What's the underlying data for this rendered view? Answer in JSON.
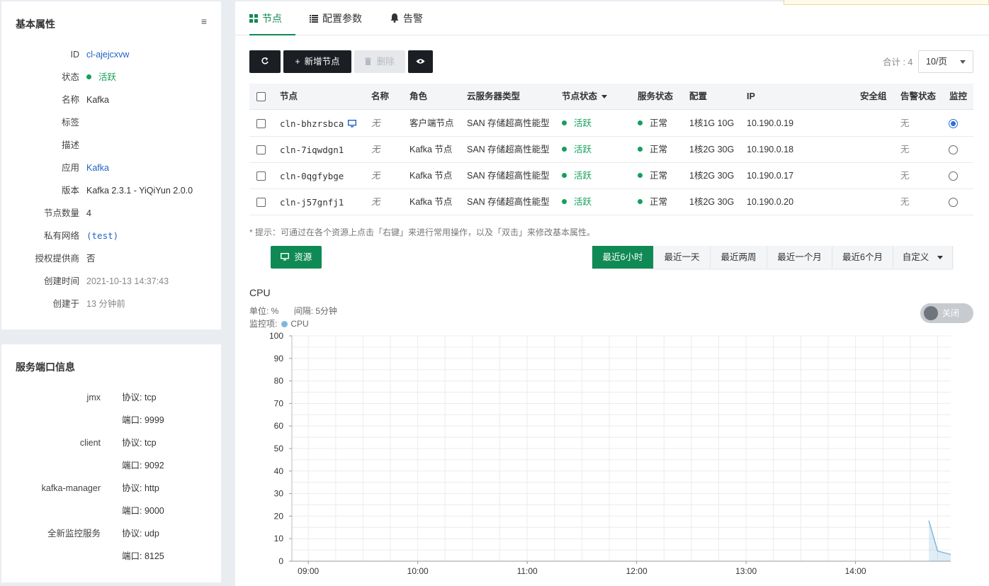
{
  "basic_info": {
    "title": "基本属性",
    "rows": [
      {
        "label": "ID",
        "value": "cl-ajejcxvw",
        "style": "link"
      },
      {
        "label": "状态",
        "value": "活跃",
        "style": "status"
      },
      {
        "label": "名称",
        "value": "Kafka",
        "style": "plain"
      },
      {
        "label": "标签",
        "value": "",
        "style": "plain"
      },
      {
        "label": "描述",
        "value": "",
        "style": "plain"
      },
      {
        "label": "应用",
        "value": "Kafka",
        "style": "link"
      },
      {
        "label": "版本",
        "value": "Kafka 2.3.1 - YiQiYun 2.0.0",
        "style": "plain"
      },
      {
        "label": "节点数量",
        "value": "4",
        "style": "plain"
      },
      {
        "label": "私有网络",
        "value": "(test)",
        "style": "link-mono"
      },
      {
        "label": "授权提供商",
        "value": "否",
        "style": "plain"
      },
      {
        "label": "创建时间",
        "value": "2021-10-13 14:37:43",
        "style": "gray"
      },
      {
        "label": "创建于",
        "value": "13 分钟前",
        "style": "gray"
      }
    ]
  },
  "ports_info": {
    "title": "服务端口信息",
    "rows": [
      {
        "label": "jmx",
        "value": "协议: tcp"
      },
      {
        "label": "",
        "value": "端口: 9999"
      },
      {
        "label": "client",
        "value": "协议: tcp"
      },
      {
        "label": "",
        "value": "端口: 9092"
      },
      {
        "label": "kafka-manager",
        "value": "协议: http"
      },
      {
        "label": "",
        "value": "端口: 9000"
      },
      {
        "label": "全新监控服务",
        "value": "协议: udp"
      },
      {
        "label": "",
        "value": "端口: 8125"
      }
    ]
  },
  "tabs": [
    {
      "label": "节点",
      "icon": "grid-icon",
      "active": true
    },
    {
      "label": "配置参数",
      "icon": "list-icon",
      "active": false
    },
    {
      "label": "告警",
      "icon": "bell-icon",
      "active": false
    }
  ],
  "toolbar": {
    "refresh_icon": "refresh-icon",
    "add_label": "新增节点",
    "delete_label": "删除",
    "view_icon": "eye-icon",
    "total_label": "合计 : 4",
    "page_size": "10/页"
  },
  "table": {
    "columns": [
      "节点",
      "名称",
      "角色",
      "云服务器类型",
      "节点状态",
      "服务状态",
      "配置",
      "IP",
      "安全组",
      "告警状态",
      "监控"
    ],
    "rows": [
      {
        "node": "cln-bhzrsbca",
        "name": "无",
        "role": "客户端节点",
        "type": "SAN 存储超高性能型",
        "node_status": "活跃",
        "service_status": "正常",
        "config": "1核1G 10G",
        "ip": "10.190.0.19",
        "security_group": "",
        "alert": "无",
        "monitored": true,
        "has_vnc": true
      },
      {
        "node": "cln-7iqwdgn1",
        "name": "无",
        "role": "Kafka 节点",
        "type": "SAN 存储超高性能型",
        "node_status": "活跃",
        "service_status": "正常",
        "config": "1核2G 30G",
        "ip": "10.190.0.18",
        "security_group": "",
        "alert": "无",
        "monitored": false,
        "has_vnc": false
      },
      {
        "node": "cln-0qgfybge",
        "name": "无",
        "role": "Kafka 节点",
        "type": "SAN 存储超高性能型",
        "node_status": "活跃",
        "service_status": "正常",
        "config": "1核2G 30G",
        "ip": "10.190.0.17",
        "security_group": "",
        "alert": "无",
        "monitored": false,
        "has_vnc": false
      },
      {
        "node": "cln-j57gnfj1",
        "name": "无",
        "role": "Kafka 节点",
        "type": "SAN 存储超高性能型",
        "node_status": "活跃",
        "service_status": "正常",
        "config": "1核2G 30G",
        "ip": "10.190.0.20",
        "security_group": "",
        "alert": "无",
        "monitored": false,
        "has_vnc": false
      }
    ]
  },
  "hint": "* 提示：可通过在各个资源上点击「右键」来进行常用操作，以及「双击」来修改基本属性。",
  "resource_button": "资源",
  "time_ranges": [
    {
      "label": "最近6小时",
      "active": true
    },
    {
      "label": "最近一天",
      "active": false
    },
    {
      "label": "最近两周",
      "active": false
    },
    {
      "label": "最近一个月",
      "active": false
    },
    {
      "label": "最近6个月",
      "active": false
    },
    {
      "label": "自定义",
      "active": false,
      "dropdown": true
    }
  ],
  "monitor": {
    "unit_text": "单位: %",
    "interval_text": "间隔: 5分钟",
    "items_label": "监控项:",
    "toggle_label": "关闭"
  },
  "colors": {
    "accent": "#0f8a55",
    "link": "#1f63c4",
    "series": "#7fb8dc"
  },
  "chart_data": {
    "type": "area",
    "title": "CPU",
    "series": [
      {
        "name": "CPU",
        "points": [
          [
            14.67,
            18
          ],
          [
            14.75,
            4.5
          ],
          [
            14.87,
            3
          ]
        ]
      }
    ],
    "x_ticks": [
      "09:00",
      "10:00",
      "11:00",
      "12:00",
      "13:00",
      "14:00"
    ],
    "x_tick_values": [
      9,
      10,
      11,
      12,
      13,
      14
    ],
    "xlim": [
      8.85,
      14.87
    ],
    "y_ticks": [
      0,
      10,
      20,
      30,
      40,
      50,
      60,
      70,
      80,
      90,
      100
    ],
    "ylim": [
      0,
      100
    ],
    "grid": true
  }
}
